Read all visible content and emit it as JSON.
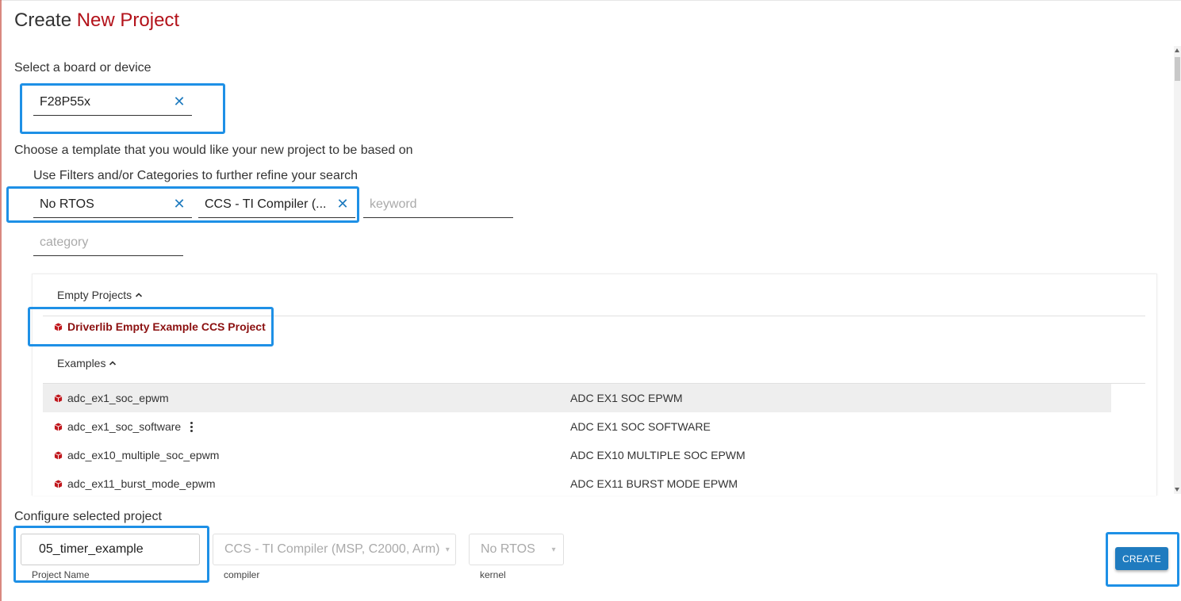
{
  "page": {
    "title_prefix": "Create ",
    "title_accent": "New Project"
  },
  "board": {
    "label": "Select a board or device",
    "value": "F28P55x"
  },
  "template": {
    "label": "Choose a template that you would like your new project to be based on",
    "filters_label": "Use Filters and/or Categories to further refine your search",
    "filter_rtos": "No RTOS",
    "filter_compiler": "CCS - TI Compiler (...",
    "keyword_placeholder": "keyword",
    "category_placeholder": "category"
  },
  "list": {
    "empty_header": "Empty Projects",
    "empty_items": [
      {
        "name": "Driverlib Empty Example CCS Project"
      }
    ],
    "examples_header": "Examples",
    "examples": [
      {
        "name": "adc_ex1_soc_epwm",
        "desc": "ADC EX1 SOC EPWM"
      },
      {
        "name": "adc_ex1_soc_software",
        "desc": "ADC EX1 SOC SOFTWARE"
      },
      {
        "name": "adc_ex10_multiple_soc_epwm",
        "desc": "ADC EX10 MULTIPLE SOC EPWM"
      },
      {
        "name": "adc_ex11_burst_mode_epwm",
        "desc": "ADC EX11 BURST MODE EPWM"
      }
    ]
  },
  "configure": {
    "label": "Configure selected project",
    "project_name": "05_timer_example",
    "project_name_label": "Project Name",
    "compiler_value": "CCS - TI Compiler (MSP, C2000, Arm)",
    "compiler_label": "compiler",
    "kernel_value": "No RTOS",
    "kernel_label": "kernel"
  },
  "actions": {
    "create_label": "CREATE"
  },
  "colors": {
    "accent_red": "#b3121a",
    "highlight_blue": "#1e90e6",
    "button_blue": "#1f7bbf"
  }
}
